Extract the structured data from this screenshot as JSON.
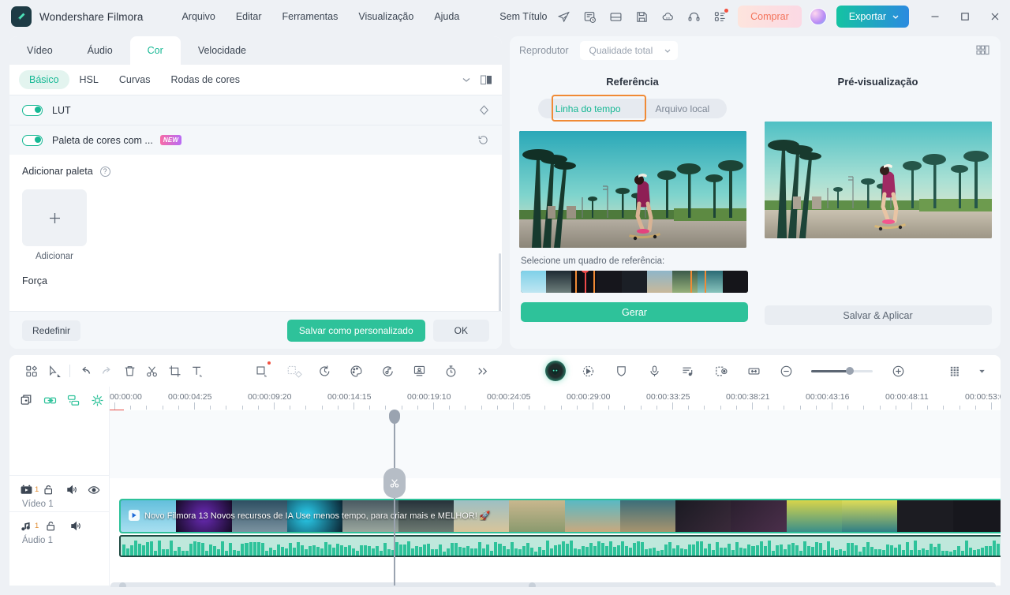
{
  "app": {
    "brand": "Wondershare Filmora",
    "document_title": "Sem Título",
    "logo_icon": "filmora-logo-icon"
  },
  "menubar": {
    "items": [
      {
        "label": "Arquivo",
        "name": "menu-arquivo"
      },
      {
        "label": "Editar",
        "name": "menu-editar"
      },
      {
        "label": "Ferramentas",
        "name": "menu-ferramentas"
      },
      {
        "label": "Visualização",
        "name": "menu-visualizacao"
      },
      {
        "label": "Ajuda",
        "name": "menu-ajuda"
      }
    ]
  },
  "title_actions": {
    "icons": [
      "send-icon",
      "task-list-icon",
      "layout-icon",
      "save-icon",
      "cloud-icon",
      "headset-icon",
      "apps-grid-icon"
    ],
    "buy_label": "Comprar",
    "export_label": "Exportar",
    "minimize": "minimize-icon",
    "maximize": "maximize-icon",
    "close": "close-icon"
  },
  "left_panel": {
    "tabs": [
      {
        "label": "Vídeo",
        "active": false
      },
      {
        "label": "Áudio",
        "active": false
      },
      {
        "label": "Cor",
        "active": true
      },
      {
        "label": "Velocidade",
        "active": false
      }
    ],
    "subtabs": [
      {
        "label": "Básico",
        "active": true
      },
      {
        "label": "HSL",
        "active": false
      },
      {
        "label": "Curvas",
        "active": false
      },
      {
        "label": "Rodas de cores",
        "active": false
      }
    ],
    "rows": [
      {
        "label": "LUT",
        "toggle_on": true,
        "badge": "",
        "right_icon": "diamond-keyframe-icon"
      },
      {
        "label": "Paleta de cores com ...",
        "toggle_on": true,
        "badge": "NEW",
        "right_icon": "reset-circular-icon"
      }
    ],
    "add_palette_label": "Adicionar paleta",
    "add_tile_label": "Adicionar",
    "strength_label": "Força",
    "footer": {
      "reset_label": "Redefinir",
      "save_custom_label": "Salvar como personalizado",
      "ok_label": "OK"
    }
  },
  "right_panel": {
    "player_label": "Reprodutor",
    "quality_value": "Qualidade total",
    "grid_icon": "layout-grid-icon",
    "reference": {
      "title": "Referência",
      "segments": [
        {
          "label": "Linha do tempo",
          "active": true,
          "highlighted": true
        },
        {
          "label": "Arquivo local",
          "active": false,
          "highlighted": false
        }
      ],
      "select_frame_label": "Selecione um quadro de referência:",
      "generate_label": "Gerar"
    },
    "preview": {
      "title": "Pré-visualização",
      "apply_label": "Salvar & Aplicar"
    }
  },
  "toolbar": {
    "left_icons": [
      "media-grid-icon",
      "select-cursor-icon",
      "undo-icon",
      "redo-icon",
      "delete-trash-icon",
      "split-scissors-icon",
      "crop-icon",
      "text-icon"
    ],
    "mid_icons": [
      "mask-square-icon",
      "keying-icon",
      "speed-ramp-icon",
      "color-palette-icon",
      "ai-audio-icon",
      "green-screen-icon",
      "stopwatch-icon",
      "more-chevrons-icon"
    ],
    "ai_icons": [
      "ai-copilot-icon",
      "motion-tracking-icon",
      "stabilization-icon",
      "voiceover-mic-icon",
      "auto-beat-sync-icon",
      "silence-detection-icon",
      "fit-timeline-icon"
    ],
    "zoom_out_icon": "zoom-out-icon",
    "zoom_in_icon": "zoom-in-icon",
    "zoom_percent": 60,
    "render_icon": "render-preview-icon",
    "render_chevron": "chevron-down-icon"
  },
  "timeline": {
    "head_tools": [
      "add-track-icon",
      "link-clips-icon",
      "auto-arrange-icon",
      "marker-icon"
    ],
    "ruler_ticks": [
      "00:00:00",
      "00:00:04:25",
      "00:00:09:20",
      "00:00:14:15",
      "00:00:19:10",
      "00:00:24:05",
      "00:00:29:00",
      "00:00:33:25",
      "00:00:38:21",
      "00:00:43:16",
      "00:00:48:11",
      "00:00:53:0"
    ],
    "tracks": [
      {
        "label": "Vídeo 1",
        "number": "1",
        "type_icon": "video-track-icon",
        "lock_icon": "unlock-icon",
        "mute_icon": "speaker-icon",
        "eye_icon": "eye-visible-icon"
      },
      {
        "label": "Áudio 1",
        "number": "1",
        "type_icon": "audio-track-icon",
        "lock_icon": "unlock-icon",
        "mute_icon": "speaker-icon"
      }
    ],
    "clip_title": "Novo Filmora 13 Novos recursos de IA  Use menos tempo, para criar mais e MELHOR! 🚀"
  },
  "colors": {
    "accent": "#2ec29a",
    "accent_text": "#16b894",
    "highlight_box": "#f08a35",
    "buy_text": "#f3735a",
    "playhead": "#9aa3b0",
    "marker_red": "#ef4a4a"
  }
}
